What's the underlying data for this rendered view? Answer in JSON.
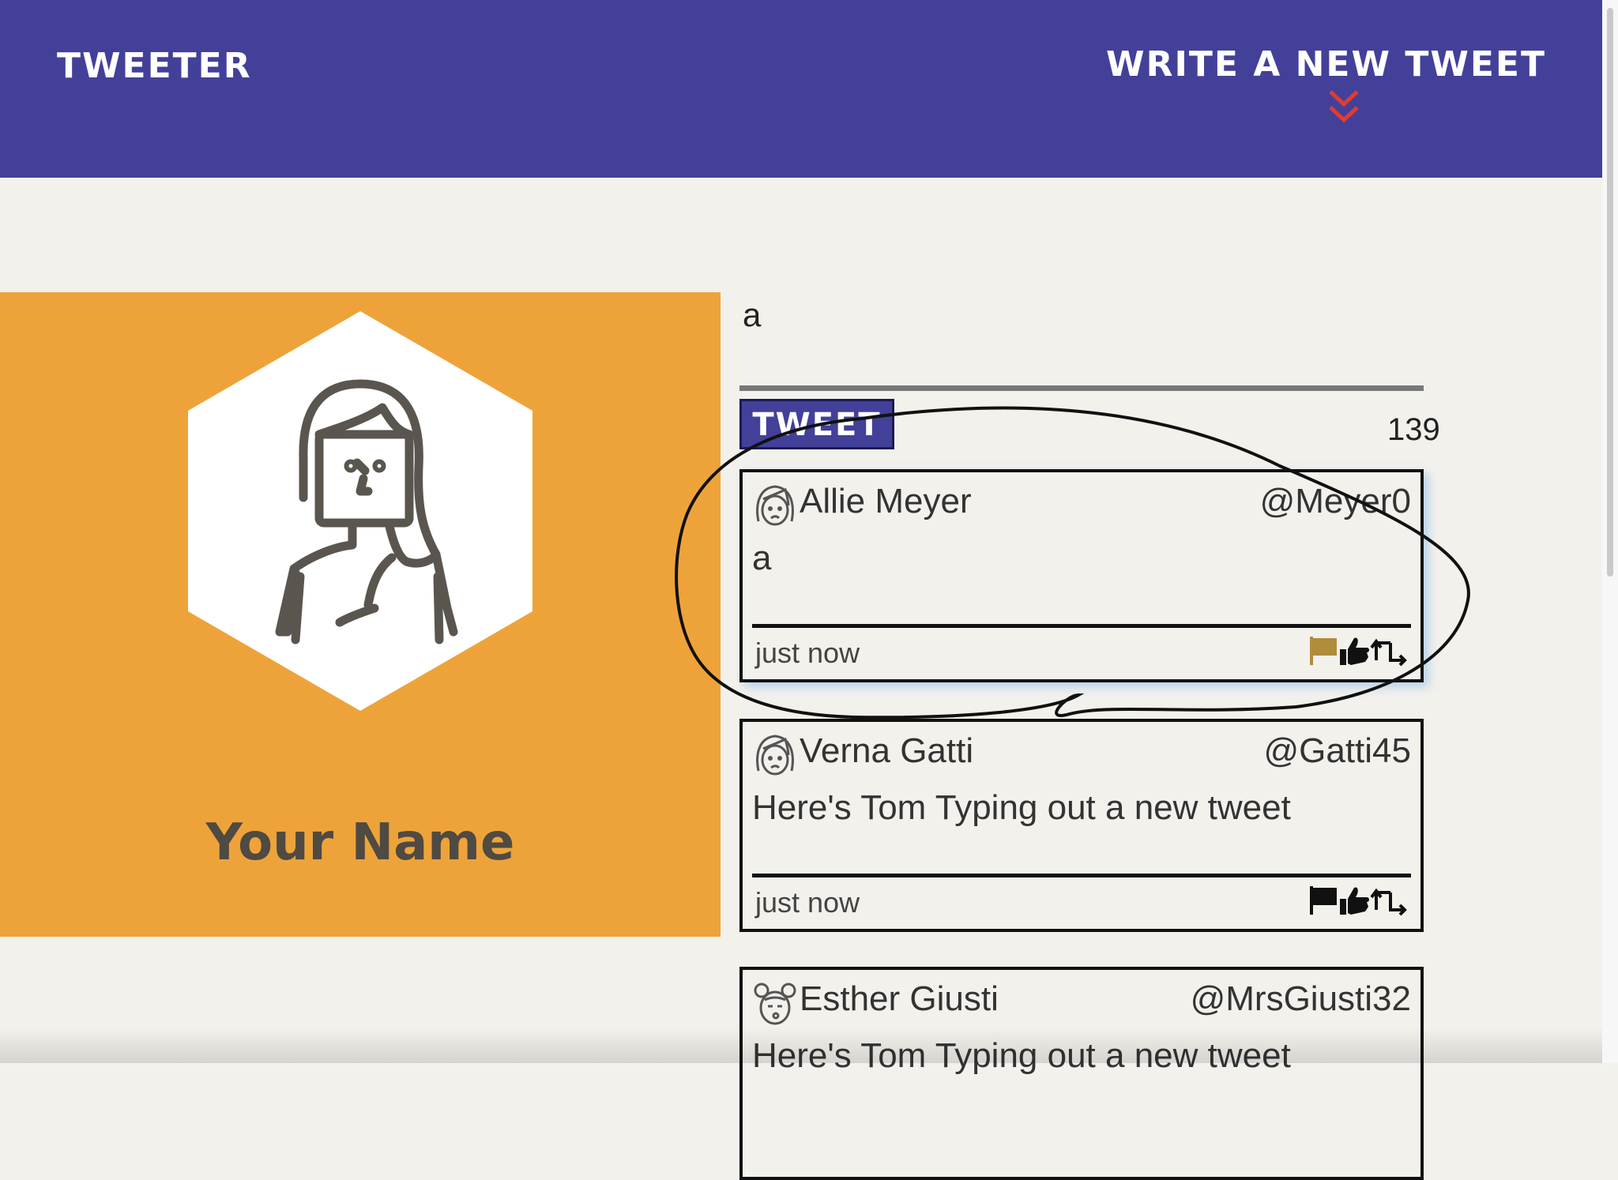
{
  "nav": {
    "brand": "TWEETER",
    "compose_link": "WRITE A NEW TWEET"
  },
  "profile": {
    "name": "Your Name"
  },
  "composer": {
    "text": "a",
    "button_label": "TWEET",
    "char_counter": "139"
  },
  "tweets": [
    {
      "name": "Allie Meyer",
      "handle": "@Meyer0",
      "body": "a",
      "time": "just now",
      "flag_color": "#b08d3c"
    },
    {
      "name": "Verna Gatti",
      "handle": "@Gatti45",
      "body": "Here's Tom Typing out a new tweet",
      "time": "just now",
      "flag_color": "#111111"
    },
    {
      "name": "Esther Giusti",
      "handle": "@MrsGiusti32",
      "body": "Here's Tom Typing out a new tweet",
      "time": "",
      "flag_color": "#111111"
    }
  ],
  "icons": [
    "chevron-down-icon",
    "avatar-icon",
    "flag-icon",
    "like-icon",
    "retweet-icon"
  ],
  "colors": {
    "nav_bg": "#43409a",
    "profile_bg": "#eea33a",
    "page_bg": "#f3f1ec",
    "accent_red": "#e33b2e"
  }
}
